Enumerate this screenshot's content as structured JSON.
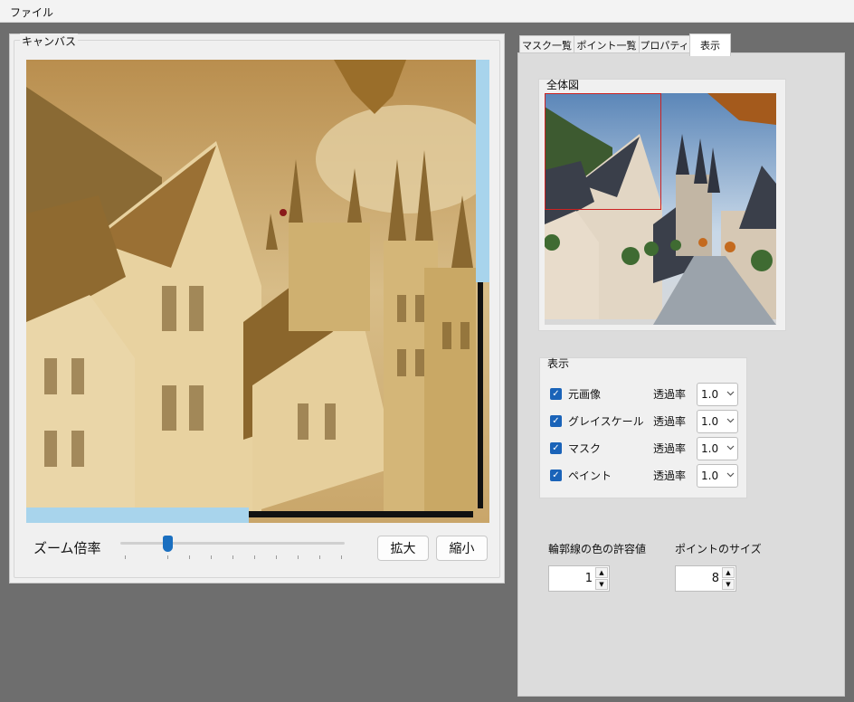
{
  "menu": {
    "file": "ファイル"
  },
  "canvas": {
    "group_label": "キャンバス",
    "zoom_label": "ズーム倍率",
    "zoom_in_label": "拡大",
    "zoom_out_label": "縮小"
  },
  "tabs": [
    {
      "label": "マスク一覧",
      "active": false
    },
    {
      "label": "ポイント一覧",
      "active": false
    },
    {
      "label": "プロパティ",
      "active": false
    },
    {
      "label": "表示",
      "active": true
    }
  ],
  "overview": {
    "label": "全体図"
  },
  "display": {
    "label": "表示",
    "opacity_label": "透過率",
    "layers": [
      {
        "label": "元画像",
        "checked": true,
        "opacity": "1.0"
      },
      {
        "label": "グレイスケール",
        "checked": true,
        "opacity": "1.0"
      },
      {
        "label": "マスク",
        "checked": true,
        "opacity": "1.0"
      },
      {
        "label": "ペイント",
        "checked": true,
        "opacity": "1.0"
      }
    ]
  },
  "tolerance": {
    "label": "輪郭線の色の許容値",
    "value": "1"
  },
  "point_size": {
    "label": "ポイントのサイズ",
    "value": "8"
  },
  "colors": {
    "accent": "#1a63b8",
    "scroll_thumb": "#a8d4ec",
    "viewport_rect": "#cc2222",
    "sepia": "#c9a565"
  }
}
